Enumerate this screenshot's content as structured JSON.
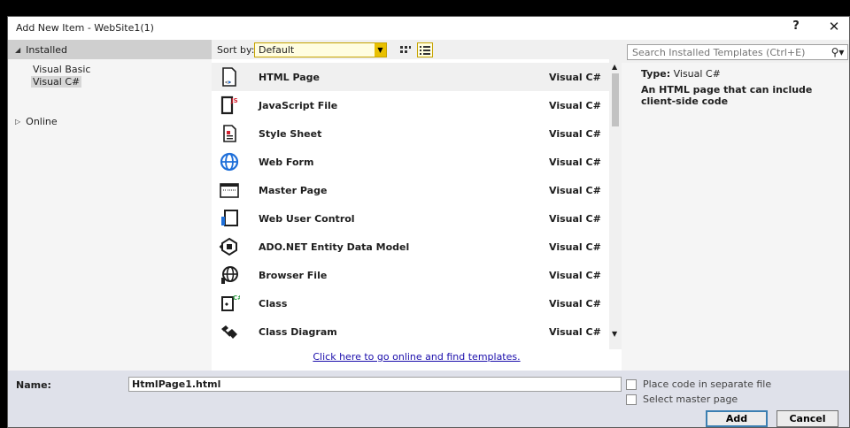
{
  "window": {
    "title": "Add New Item - WebSite1(1)",
    "help_label": "?",
    "close_label": "✕"
  },
  "left_pane": {
    "installed_label": "Installed",
    "items": [
      {
        "label": "Visual Basic"
      },
      {
        "label": "Visual C#"
      }
    ],
    "online_label": "Online"
  },
  "toolbar": {
    "sort_label": "Sort by:",
    "sort_value": "Default"
  },
  "templates": [
    {
      "name": "HTML Page",
      "lang": "Visual C#",
      "icon": "html-page-icon"
    },
    {
      "name": "JavaScript File",
      "lang": "Visual C#",
      "icon": "javascript-file-icon"
    },
    {
      "name": "Style Sheet",
      "lang": "Visual C#",
      "icon": "style-sheet-icon"
    },
    {
      "name": "Web Form",
      "lang": "Visual C#",
      "icon": "web-form-icon"
    },
    {
      "name": "Master Page",
      "lang": "Visual C#",
      "icon": "master-page-icon"
    },
    {
      "name": "Web User Control",
      "lang": "Visual C#",
      "icon": "web-user-control-icon"
    },
    {
      "name": "ADO.NET Entity Data Model",
      "lang": "Visual C#",
      "icon": "entity-data-model-icon"
    },
    {
      "name": "Browser File",
      "lang": "Visual C#",
      "icon": "browser-file-icon"
    },
    {
      "name": "Class",
      "lang": "Visual C#",
      "icon": "class-icon"
    },
    {
      "name": "Class Diagram",
      "lang": "Visual C#",
      "icon": "class-diagram-icon"
    }
  ],
  "online_link": "Click here to go online and find templates.",
  "search": {
    "placeholder": "Search Installed Templates (Ctrl+E)"
  },
  "details": {
    "type_label": "Type:",
    "type_value": "Visual C#",
    "description": "An HTML page that can include client-side code"
  },
  "bottom": {
    "name_label": "Name:",
    "name_value": "HtmlPage1.html",
    "checkbox_separate": "Place code in separate file",
    "checkbox_master": "Select master page",
    "add_label": "Add",
    "cancel_label": "Cancel"
  },
  "colors": {
    "accent_yellow": "#e8c000",
    "link_blue": "#1a0dab",
    "bottom_bar": "#dfe1ea"
  }
}
